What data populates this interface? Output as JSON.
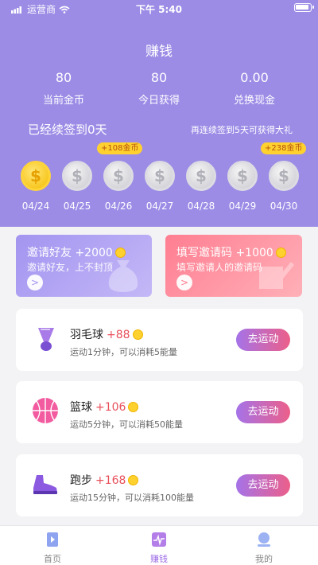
{
  "status_bar": {
    "carrier": "运营商",
    "time": "下午 5:40"
  },
  "header": {
    "title": "赚钱",
    "stats": [
      {
        "value": "80",
        "label": "当前金币"
      },
      {
        "value": "80",
        "label": "今日获得"
      },
      {
        "value": "0.00",
        "label": "兑换现金"
      }
    ],
    "streak_text": "已经续签到0天",
    "streak_tip": "再连续签到5天可获得大礼",
    "bonuses": [
      "+108金币",
      "+238金币"
    ],
    "days": [
      {
        "date": "04/24",
        "state": "gold"
      },
      {
        "date": "04/25",
        "state": "silver"
      },
      {
        "date": "04/26",
        "state": "silver"
      },
      {
        "date": "04/27",
        "state": "silver"
      },
      {
        "date": "04/28",
        "state": "silver"
      },
      {
        "date": "04/29",
        "state": "silver"
      },
      {
        "date": "04/30",
        "state": "silver"
      }
    ],
    "coin_symbol": "$"
  },
  "invite_cards": [
    {
      "title": "邀请好友 +2000",
      "subtitle": "邀请好友，上不封顶",
      "arrow": ">",
      "colors": [
        "#a394f0",
        "#c4b8f7"
      ]
    },
    {
      "title": "填写邀请码 +1000",
      "subtitle": "填写邀请人的邀请码",
      "arrow": ">",
      "colors": [
        "#ff7e91",
        "#ffb0b8"
      ]
    }
  ],
  "sports": [
    {
      "name": "羽毛球",
      "points": "+88",
      "desc": "运动1分钟，可以消耗5能量",
      "button": "去运动",
      "icon": "badminton-icon"
    },
    {
      "name": "篮球",
      "points": "+106",
      "desc": "运动5分钟，可以消耗50能量",
      "button": "去运动",
      "icon": "basketball-icon"
    },
    {
      "name": "跑步",
      "points": "+168",
      "desc": "运动15分钟，可以消耗100能量",
      "button": "去运动",
      "icon": "running-shoe-icon"
    }
  ],
  "tabbar": [
    {
      "label": "首页",
      "icon": "home-icon",
      "active": false
    },
    {
      "label": "赚钱",
      "icon": "earn-icon",
      "active": true
    },
    {
      "label": "我的",
      "icon": "profile-icon",
      "active": false
    }
  ],
  "colors": {
    "header_bg": "#9c8ce6",
    "accent": "#9c6be6",
    "points_red": "#e8505b",
    "gold": "#ffd12e"
  }
}
